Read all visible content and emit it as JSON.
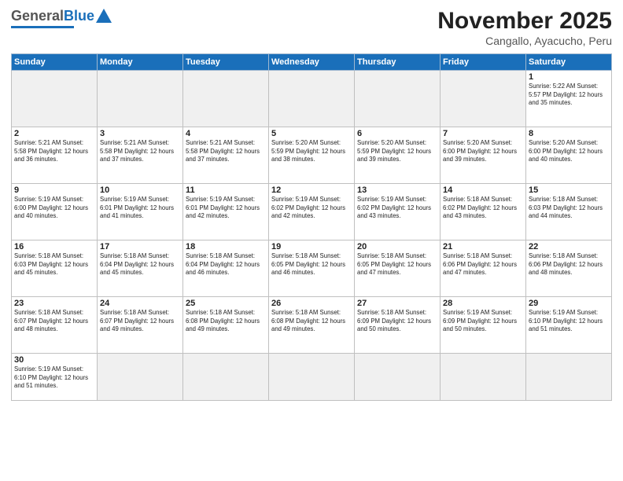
{
  "logo": {
    "general": "General",
    "blue": "Blue"
  },
  "header": {
    "month": "November 2025",
    "location": "Cangallo, Ayacucho, Peru"
  },
  "weekdays": [
    "Sunday",
    "Monday",
    "Tuesday",
    "Wednesday",
    "Thursday",
    "Friday",
    "Saturday"
  ],
  "weeks": [
    [
      {
        "day": "",
        "info": ""
      },
      {
        "day": "",
        "info": ""
      },
      {
        "day": "",
        "info": ""
      },
      {
        "day": "",
        "info": ""
      },
      {
        "day": "",
        "info": ""
      },
      {
        "day": "",
        "info": ""
      },
      {
        "day": "1",
        "info": "Sunrise: 5:22 AM\nSunset: 5:57 PM\nDaylight: 12 hours and 35 minutes."
      }
    ],
    [
      {
        "day": "2",
        "info": "Sunrise: 5:21 AM\nSunset: 5:58 PM\nDaylight: 12 hours and 36 minutes."
      },
      {
        "day": "3",
        "info": "Sunrise: 5:21 AM\nSunset: 5:58 PM\nDaylight: 12 hours and 37 minutes."
      },
      {
        "day": "4",
        "info": "Sunrise: 5:21 AM\nSunset: 5:58 PM\nDaylight: 12 hours and 37 minutes."
      },
      {
        "day": "5",
        "info": "Sunrise: 5:20 AM\nSunset: 5:59 PM\nDaylight: 12 hours and 38 minutes."
      },
      {
        "day": "6",
        "info": "Sunrise: 5:20 AM\nSunset: 5:59 PM\nDaylight: 12 hours and 39 minutes."
      },
      {
        "day": "7",
        "info": "Sunrise: 5:20 AM\nSunset: 6:00 PM\nDaylight: 12 hours and 39 minutes."
      },
      {
        "day": "8",
        "info": "Sunrise: 5:20 AM\nSunset: 6:00 PM\nDaylight: 12 hours and 40 minutes."
      }
    ],
    [
      {
        "day": "9",
        "info": "Sunrise: 5:19 AM\nSunset: 6:00 PM\nDaylight: 12 hours and 40 minutes."
      },
      {
        "day": "10",
        "info": "Sunrise: 5:19 AM\nSunset: 6:01 PM\nDaylight: 12 hours and 41 minutes."
      },
      {
        "day": "11",
        "info": "Sunrise: 5:19 AM\nSunset: 6:01 PM\nDaylight: 12 hours and 42 minutes."
      },
      {
        "day": "12",
        "info": "Sunrise: 5:19 AM\nSunset: 6:02 PM\nDaylight: 12 hours and 42 minutes."
      },
      {
        "day": "13",
        "info": "Sunrise: 5:19 AM\nSunset: 6:02 PM\nDaylight: 12 hours and 43 minutes."
      },
      {
        "day": "14",
        "info": "Sunrise: 5:18 AM\nSunset: 6:02 PM\nDaylight: 12 hours and 43 minutes."
      },
      {
        "day": "15",
        "info": "Sunrise: 5:18 AM\nSunset: 6:03 PM\nDaylight: 12 hours and 44 minutes."
      }
    ],
    [
      {
        "day": "16",
        "info": "Sunrise: 5:18 AM\nSunset: 6:03 PM\nDaylight: 12 hours and 45 minutes."
      },
      {
        "day": "17",
        "info": "Sunrise: 5:18 AM\nSunset: 6:04 PM\nDaylight: 12 hours and 45 minutes."
      },
      {
        "day": "18",
        "info": "Sunrise: 5:18 AM\nSunset: 6:04 PM\nDaylight: 12 hours and 46 minutes."
      },
      {
        "day": "19",
        "info": "Sunrise: 5:18 AM\nSunset: 6:05 PM\nDaylight: 12 hours and 46 minutes."
      },
      {
        "day": "20",
        "info": "Sunrise: 5:18 AM\nSunset: 6:05 PM\nDaylight: 12 hours and 47 minutes."
      },
      {
        "day": "21",
        "info": "Sunrise: 5:18 AM\nSunset: 6:06 PM\nDaylight: 12 hours and 47 minutes."
      },
      {
        "day": "22",
        "info": "Sunrise: 5:18 AM\nSunset: 6:06 PM\nDaylight: 12 hours and 48 minutes."
      }
    ],
    [
      {
        "day": "23",
        "info": "Sunrise: 5:18 AM\nSunset: 6:07 PM\nDaylight: 12 hours and 48 minutes."
      },
      {
        "day": "24",
        "info": "Sunrise: 5:18 AM\nSunset: 6:07 PM\nDaylight: 12 hours and 49 minutes."
      },
      {
        "day": "25",
        "info": "Sunrise: 5:18 AM\nSunset: 6:08 PM\nDaylight: 12 hours and 49 minutes."
      },
      {
        "day": "26",
        "info": "Sunrise: 5:18 AM\nSunset: 6:08 PM\nDaylight: 12 hours and 49 minutes."
      },
      {
        "day": "27",
        "info": "Sunrise: 5:18 AM\nSunset: 6:09 PM\nDaylight: 12 hours and 50 minutes."
      },
      {
        "day": "28",
        "info": "Sunrise: 5:19 AM\nSunset: 6:09 PM\nDaylight: 12 hours and 50 minutes."
      },
      {
        "day": "29",
        "info": "Sunrise: 5:19 AM\nSunset: 6:10 PM\nDaylight: 12 hours and 51 minutes."
      }
    ],
    [
      {
        "day": "30",
        "info": "Sunrise: 5:19 AM\nSunset: 6:10 PM\nDaylight: 12 hours and 51 minutes."
      },
      {
        "day": "",
        "info": ""
      },
      {
        "day": "",
        "info": ""
      },
      {
        "day": "",
        "info": ""
      },
      {
        "day": "",
        "info": ""
      },
      {
        "day": "",
        "info": ""
      },
      {
        "day": "",
        "info": ""
      }
    ]
  ]
}
